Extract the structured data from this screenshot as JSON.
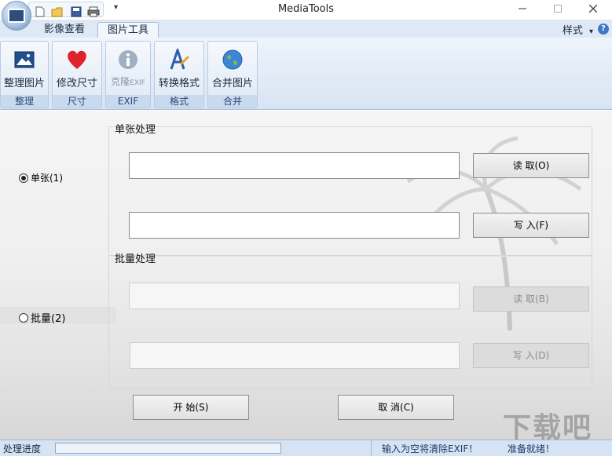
{
  "window": {
    "title": "MediaTools"
  },
  "quick_access": {
    "icons": [
      "new-file-icon",
      "open-folder-icon",
      "save-icon",
      "print-icon"
    ],
    "dropdown": "▾"
  },
  "tabs": [
    {
      "label": "影像查看"
    },
    {
      "label": "图片工具"
    }
  ],
  "style_menu": {
    "label": "样式",
    "arrow": "▾"
  },
  "help": {
    "glyph": "?"
  },
  "ribbon": {
    "groups": [
      {
        "title": "整理",
        "button": "整理图片",
        "icon": "image-icon"
      },
      {
        "title": "尺寸",
        "button": "修改尺寸",
        "icon": "heart-icon"
      },
      {
        "title": "EXIF",
        "button_prefix": "克隆",
        "button_suffix": "EXIF",
        "icon": "info-icon"
      },
      {
        "title": "格式",
        "button": "转换格式",
        "icon": "convert-icon"
      },
      {
        "title": "合并",
        "button": "合并图片",
        "icon": "globe-icon"
      }
    ]
  },
  "main": {
    "single": {
      "radio_label": "单张(1)",
      "section_label": "单张处理",
      "read_button": "读 取(O)",
      "write_button": "写 入(F)",
      "input_value": "",
      "output_value": ""
    },
    "batch": {
      "radio_label": "批量(2)",
      "section_label": "批量处理",
      "read_button": "读 取(B)",
      "write_button": "写 入(D)",
      "input_value": "",
      "output_value": ""
    },
    "start_button": "开 始(S)",
    "cancel_button": "取 消(C)"
  },
  "statusbar": {
    "progress_label": "处理进度",
    "message": "输入为空将清除EXIF！",
    "ready": "准备就绪！",
    "progress": 0
  },
  "watermark": "下载吧"
}
